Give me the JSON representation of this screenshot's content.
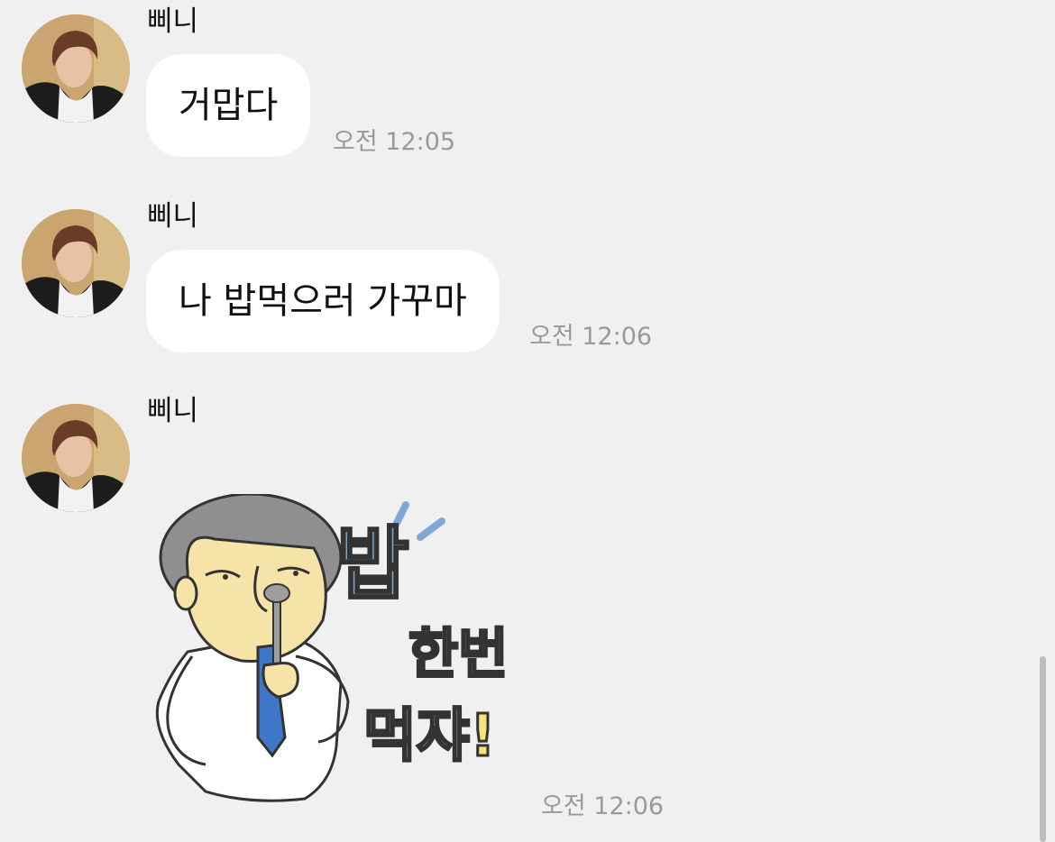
{
  "chat": {
    "messages": [
      {
        "sender": "삐니",
        "text": "거맙다",
        "time": "오전 12:05"
      },
      {
        "sender": "삐니",
        "text": "나 밥먹으러 가꾸마",
        "time": "오전 12:06"
      },
      {
        "sender": "삐니",
        "sticker": {
          "line1": "밥",
          "line2": "한번",
          "line3": "먹쟈!"
        },
        "time": "오전 12:06"
      }
    ]
  },
  "colors": {
    "background": "#f0f0f0",
    "bubble": "#ffffff",
    "time_text": "#9a9a9a",
    "sticker_blue": "#7fa6d6",
    "sticker_yellow": "#f3e37a"
  },
  "icons": {
    "avatar": "profile-photo-icon",
    "sticker": "eating-man-sticker-icon"
  }
}
